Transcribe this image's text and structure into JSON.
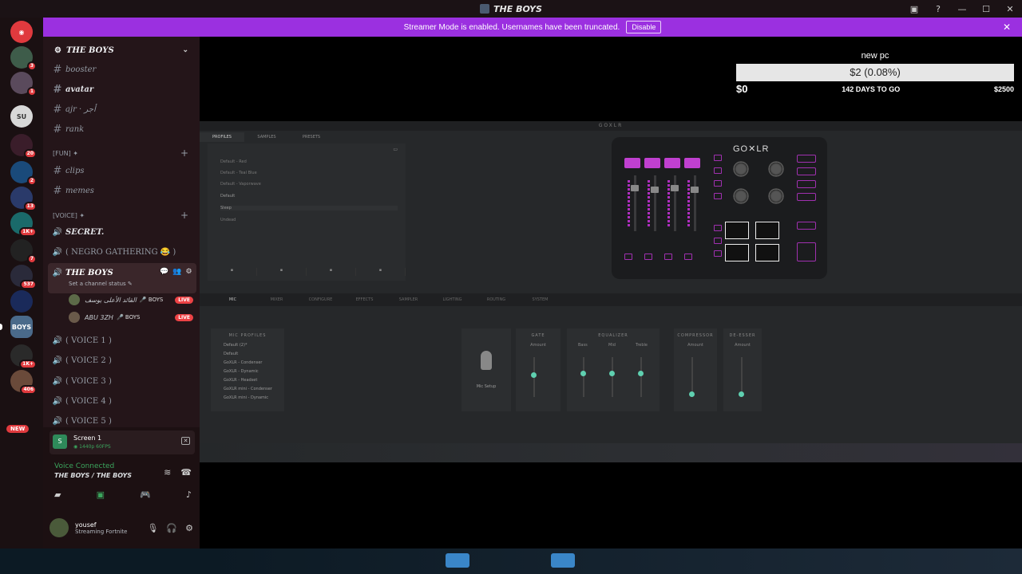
{
  "window": {
    "title": "THE BOYS",
    "controls": [
      "—",
      "☐",
      "✕"
    ],
    "inbox_icon": "inbox-icon",
    "help_icon": "help-icon"
  },
  "banner": {
    "text": "Streamer Mode is enabled. Usernames have been truncated.",
    "disable_label": "Disable",
    "close": "✕"
  },
  "server_rail": {
    "servers": [
      {
        "name": "discord-home",
        "badge": ""
      },
      {
        "name": "server-1",
        "badge": "3"
      },
      {
        "name": "server-2",
        "badge": "1"
      },
      {
        "name": "server-3",
        "badge": ""
      },
      {
        "name": "server-4",
        "badge": "20"
      },
      {
        "name": "server-5",
        "badge": "2"
      },
      {
        "name": "server-6",
        "badge": "13"
      },
      {
        "name": "server-7",
        "badge": "1K+"
      },
      {
        "name": "server-8",
        "badge": "7"
      },
      {
        "name": "server-9",
        "badge": "537"
      },
      {
        "name": "server-10",
        "badge": ""
      },
      {
        "name": "the-boys",
        "badge": ""
      },
      {
        "name": "server-12",
        "badge": "1K+"
      },
      {
        "name": "server-13",
        "badge": "406"
      }
    ],
    "new_label": "NEW"
  },
  "sidebar": {
    "server_name": "THE BOYS",
    "text_channels": [
      {
        "name": "booster"
      },
      {
        "name": "avatar"
      },
      {
        "name": "ajr · أجر"
      },
      {
        "name": "rank"
      }
    ],
    "fun_category": "[FUN] ✦",
    "fun_channels": [
      {
        "name": "clips"
      },
      {
        "name": "memes"
      }
    ],
    "voice_category": "[VOICE] ✦",
    "voice_top": [
      {
        "name": "SECRET."
      },
      {
        "name": "( NEGRO GATHERING 😂 )"
      }
    ],
    "active_voice": "THE BOYS",
    "set_status": "Set a channel status ✎",
    "members": [
      {
        "name": "القائد الأعلى يوسف",
        "tag": "🎤 BOYS",
        "live": "LIVE"
      },
      {
        "name": "ABU 3ZH",
        "tag": "🎤 BOYS",
        "live": "LIVE"
      }
    ],
    "voice_rooms": [
      {
        "name": "( VOICE 1 )"
      },
      {
        "name": "( VOICE 2 )"
      },
      {
        "name": "( VOICE 3 )"
      },
      {
        "name": "( VOICE 4 )"
      },
      {
        "name": "( VOICE 5 )"
      }
    ]
  },
  "panel": {
    "screen_title": "Screen 1",
    "screen_sub": "◉ 1440p 60FPS",
    "voice_connected": "Voice Connected",
    "voice_location": "THE BOYS / THE BOYS",
    "user_name": "yousef",
    "user_status": "Streaming Fortnite"
  },
  "goal": {
    "title": "new pc",
    "amount": "$2 (0.08%)",
    "start": "$0",
    "days": "142 DAYS TO GO",
    "target": "$2500",
    "progress": 0.0008
  },
  "goxlr": {
    "window_title": "GOXLR",
    "tabs": [
      "PROFILES",
      "SAMPLES",
      "PRESETS"
    ],
    "profiles": [
      "Default - Red",
      "Default - Teal Blue",
      "Default - Vaporwave",
      "Default",
      "Sleep",
      "Undead"
    ],
    "device_logo": "GO✕LR",
    "sections": [
      "MIC",
      "MIXER",
      "CONFIGURE",
      "EFFECTS",
      "SAMPLER",
      "LIGHTING",
      "ROUTING",
      "SYSTEM"
    ],
    "mic_profiles_title": "MIC PROFILES",
    "mic_profiles": [
      "Default (2)*",
      "Default",
      "GoXLR - Condenser",
      "GoXLR - Dynamic",
      "GoXLR - Headset",
      "GoXLR mini - Condenser",
      "GoXLR mini - Dynamic"
    ],
    "mic_setup": "Mic Setup",
    "gate": "GATE",
    "amount": "Amount",
    "equalizer": "EQUALIZER",
    "eq_bands": [
      "Bass",
      "Mid",
      "Treble"
    ],
    "compressor": "COMPRESSOR",
    "deesser": "DE-ESSER"
  }
}
